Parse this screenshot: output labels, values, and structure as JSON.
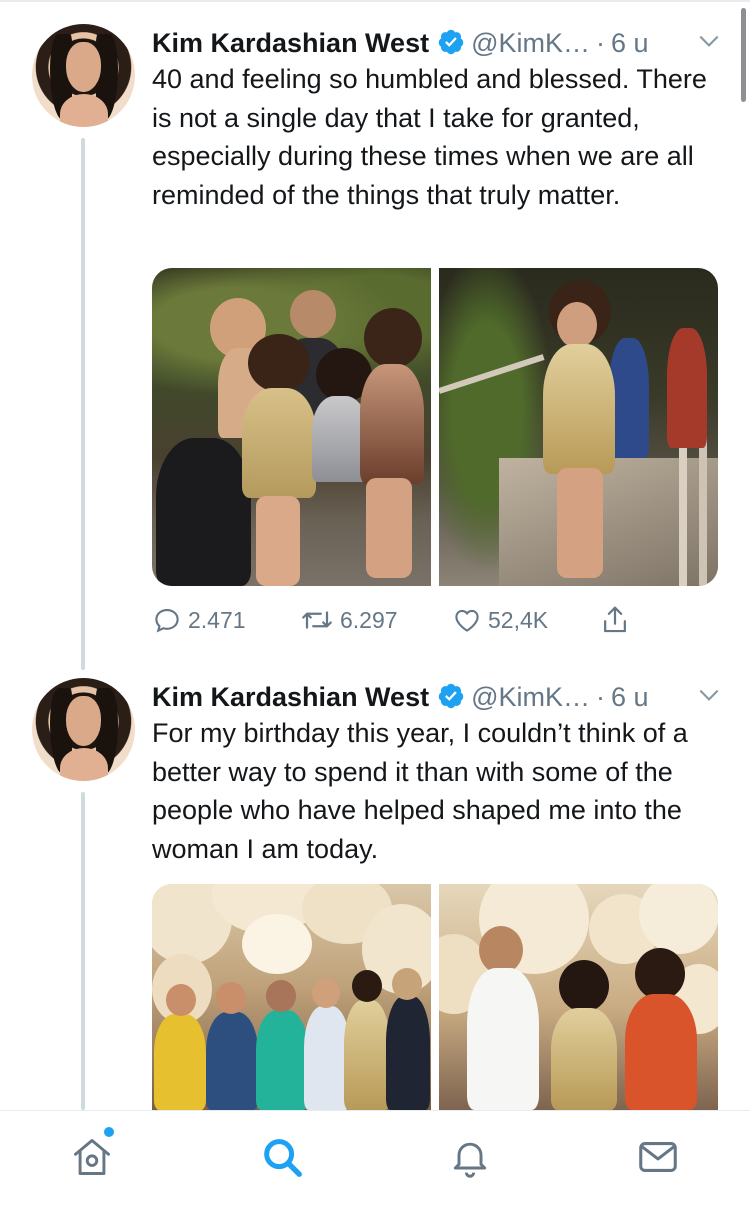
{
  "tweets": [
    {
      "author_name": "Kim Kardashian West",
      "handle": "@KimK…",
      "separator": "·",
      "time": "6 u",
      "text": "40 and feeling so humbled and blessed. There is not a single day that I take for granted, especially during these times when we are all reminded of the things that truly matter.",
      "replies": "2.471",
      "retweets": "6.297",
      "likes": "52,4K"
    },
    {
      "author_name": "Kim Kardashian West",
      "handle": "@KimK…",
      "separator": "·",
      "time": "6 u",
      "text": "For my birthday this year, I couldn’t think of a better way to spend it than with some of the people who have helped shaped me into the woman I am today."
    }
  ],
  "tabbar": {
    "items": [
      "home-icon",
      "search-icon",
      "notifications-icon",
      "messages-icon"
    ],
    "active": "search-icon",
    "accent_color": "#1da1f2",
    "has_home_notification_dot": true
  },
  "colors": {
    "text": "#14171a",
    "secondary": "#657786",
    "verified": "#1da1f2",
    "thread_line": "#cfd9de"
  }
}
